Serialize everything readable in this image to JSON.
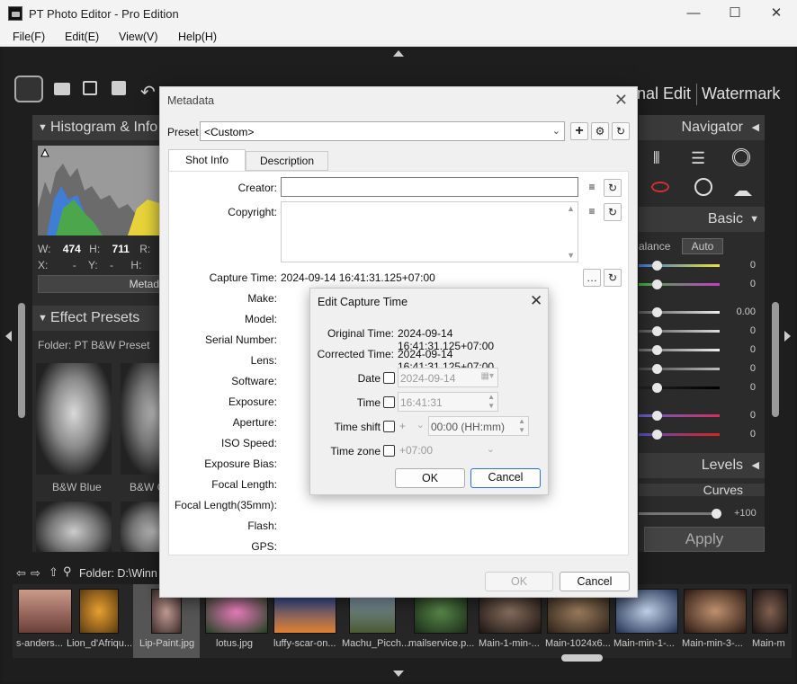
{
  "window": {
    "title": "PT Photo Editor - Pro Edition",
    "minimize": "—",
    "maximize": "☐",
    "close": "✕"
  },
  "menu": {
    "file": "File(F)",
    "edit": "Edit(E)",
    "view": "View(V)",
    "help": "Help(H)"
  },
  "top_tabs": {
    "final_edit": "nal Edit",
    "watermark": "Watermark"
  },
  "left": {
    "histogram_title": "Histogram & Info",
    "info": {
      "w_label": "W:",
      "w": "474",
      "h_label": "H:",
      "h": "711",
      "r_label": "R:",
      "x_label": "X:",
      "x": "-",
      "y_label": "Y:",
      "y": "-",
      "h2_label": "H:"
    },
    "metadata_button": "Metad",
    "effect_title": "Effect Presets",
    "folder": "Folder:  PT B&W Preset",
    "preset1": "B&W Blue",
    "preset2": "B&W C"
  },
  "right": {
    "navigator": "Navigator",
    "basic": "Basic",
    "balance": "alance",
    "auto": "Auto",
    "values": [
      "0",
      "0",
      "0.00",
      "0",
      "0",
      "0",
      "0",
      "0",
      "0"
    ],
    "levels": "Levels",
    "curves": "Curves",
    "plus100": "+100",
    "apply": "Apply"
  },
  "bottom": {
    "folder": "Folder:  D:\\Winn"
  },
  "filmstrip": [
    {
      "name": "s-anders..."
    },
    {
      "name": "Lion_d'Afriqu..."
    },
    {
      "name": "Lip-Paint.jpg"
    },
    {
      "name": "lotus.jpg"
    },
    {
      "name": "luffy-scar-on..."
    },
    {
      "name": "Machu_Picch..."
    },
    {
      "name": "mailservice.p..."
    },
    {
      "name": "Main-1-min-..."
    },
    {
      "name": "Main-1024x6..."
    },
    {
      "name": "Main-min-1-..."
    },
    {
      "name": "Main-min-3-..."
    },
    {
      "name": "Main-m"
    }
  ],
  "metadata": {
    "title": "Metadata",
    "preset_label": "Preset",
    "preset_value": "<Custom>",
    "tabs": {
      "shot_info": "Shot Info",
      "description": "Description"
    },
    "fields": {
      "creator": "Creator:",
      "copyright": "Copyright:",
      "capture_time": "Capture Time:",
      "capture_time_value": "2024-09-14 16:41:31.125+07:00",
      "make": "Make:",
      "model": "Model:",
      "serial": "Serial Number:",
      "lens": "Lens:",
      "software": "Software:",
      "exposure": "Exposure:",
      "aperture": "Aperture:",
      "iso": "ISO Speed:",
      "bias": "Exposure Bias:",
      "focal": "Focal Length:",
      "focal35": "Focal Length(35mm):",
      "flash": "Flash:",
      "gps": "GPS:"
    },
    "ok": "OK",
    "cancel": "Cancel"
  },
  "capture_dialog": {
    "title": "Edit Capture Time",
    "original_label": "Original Time:",
    "original_value": "2024-09-14 16:41:31.125+07:00",
    "corrected_label": "Corrected Time:",
    "corrected_value": "2024-09-14 16:41:31.125+07:00",
    "date_label": "Date",
    "date_value": "2024-09-14",
    "time_label": "Time",
    "time_value": "16:41:31",
    "shift_label": "Time shift",
    "shift_sign": "+",
    "shift_value": "00:00 (HH:mm)",
    "zone_label": "Time zone",
    "zone_value": "+07:00",
    "ok": "OK",
    "cancel": "Cancel"
  },
  "colors": {
    "accent": "#2f6fd4",
    "dark_bg": "#1e1e1e",
    "panel": "#2b2b2b"
  }
}
